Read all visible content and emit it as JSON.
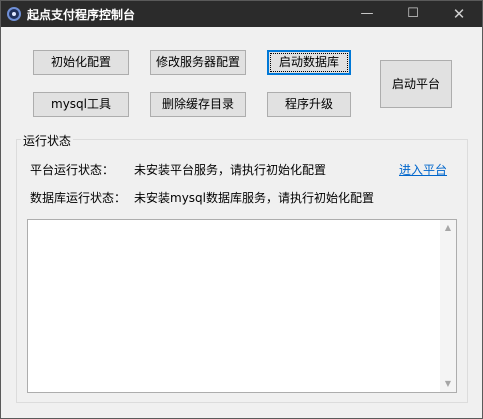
{
  "window": {
    "title": "起点支付程序控制台"
  },
  "titlebar": {
    "minimize_glyph": "—",
    "maximize_glyph": "☐",
    "close_glyph": "✕"
  },
  "toolbar": {
    "init_config": "初始化配置",
    "modify_server": "修改服务器配置",
    "start_database": "启动数据库",
    "mysql_tool": "mysql工具",
    "delete_cache": "删除缓存目录",
    "upgrade": "程序升级",
    "start_platform": "启动平台"
  },
  "status": {
    "group_label": "运行状态",
    "platform_label": "平台运行状态：",
    "platform_value": "未安装平台服务，请执行初始化配置",
    "enter_platform_link": "进入平台",
    "db_label": "数据库运行状态：",
    "db_value": "未安装mysql数据库服务，请执行初始化配置"
  },
  "log": {
    "text": ""
  },
  "icons": {
    "app": "app-logo-icon",
    "minimize": "minimize-icon",
    "maximize": "maximize-icon",
    "close": "close-icon",
    "scroll_up": "scroll-up-arrow-icon",
    "scroll_down": "scroll-down-arrow-icon"
  },
  "colors": {
    "titlebar": "#2b2b2b",
    "accent": "#0078d7",
    "link": "#0066cc"
  }
}
